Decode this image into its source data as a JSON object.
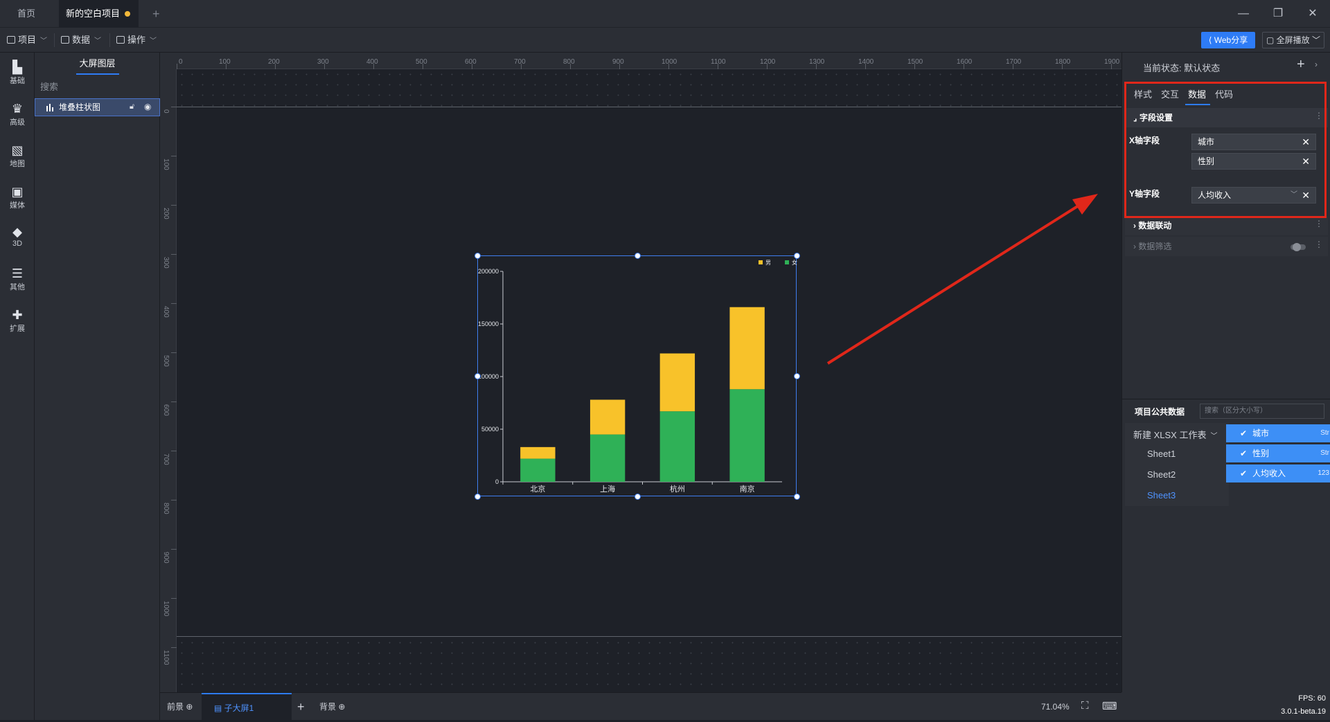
{
  "window": {
    "tabs": [
      "首页",
      "新的空白项目"
    ],
    "add_tab": "+",
    "controls": {
      "minimize": "—",
      "restore": "❐",
      "close": "✕"
    }
  },
  "menubar": {
    "items": [
      "项目",
      "数据",
      "操作"
    ],
    "web_share": "Web分享",
    "fullscreen": "全屏播放"
  },
  "iconbar": {
    "items": [
      {
        "label": "基础",
        "icon": "bar-chart-icon"
      },
      {
        "label": "高级",
        "icon": "crown-icon"
      },
      {
        "label": "地图",
        "icon": "map-icon"
      },
      {
        "label": "媒体",
        "icon": "media-icon"
      },
      {
        "label": "3D",
        "icon": "cube-icon"
      },
      {
        "label": "其他",
        "icon": "list-icon"
      },
      {
        "label": "扩展",
        "icon": "puzzle-icon"
      }
    ]
  },
  "layers": {
    "title": "大屏图层",
    "search_placeholder": "搜索",
    "items": [
      {
        "label": "堆叠柱状图"
      }
    ]
  },
  "ruler": {
    "top": [
      "0",
      "100",
      "200",
      "300",
      "400",
      "500",
      "600",
      "700",
      "800",
      "900",
      "1000",
      "1100",
      "1200",
      "1300",
      "1400",
      "1500",
      "1600",
      "1700",
      "1800",
      "1900"
    ],
    "left": [
      "0",
      "100",
      "200",
      "300",
      "400",
      "500",
      "600",
      "700",
      "800",
      "900",
      "1000",
      "1100"
    ]
  },
  "chart_data": {
    "type": "bar",
    "stacked": true,
    "categories": [
      "北京",
      "上海",
      "杭州",
      "南京"
    ],
    "series": [
      {
        "name": "女",
        "color": "#2fb157",
        "values": [
          22000,
          45000,
          67000,
          88000
        ]
      },
      {
        "name": "男",
        "color": "#f8c22a",
        "values": [
          11000,
          33000,
          55000,
          78000
        ]
      }
    ],
    "ylim": [
      0,
      200000
    ],
    "yticks": [
      "0",
      "50000",
      "100000",
      "150000",
      "200000"
    ],
    "legend": "top-right",
    "grid": false
  },
  "bottombar": {
    "front": "前景",
    "sub_screen": "子大屏1",
    "add": "+",
    "background": "背景",
    "zoom": "71.04%"
  },
  "status": {
    "fps": "FPS: 60",
    "version": "3.0.1-beta.19"
  },
  "rightpanel": {
    "state_label": "当前状态:  默认状态",
    "tabs": [
      "样式",
      "交互",
      "数据",
      "代码"
    ],
    "active_tab": "数据",
    "field_section": "字段设置",
    "x_label": "X轴字段",
    "x_fields": [
      "城市",
      "性别"
    ],
    "y_label": "Y轴字段",
    "y_field": "人均收入",
    "link_section": "数据联动",
    "filter_section": "数据筛选"
  },
  "public_data": {
    "title": "项目公共数据",
    "search_placeholder": "搜索（区分大小写）",
    "workbook": "新建 XLSX 工作表",
    "sheets": [
      "Sheet1",
      "Sheet2",
      "Sheet3"
    ],
    "active_sheet": "Sheet3",
    "columns": [
      {
        "name": "城市",
        "type": "Str"
      },
      {
        "name": "性别",
        "type": "Str"
      },
      {
        "name": "人均收入",
        "type": "123"
      }
    ]
  },
  "colors": {
    "accent": "#2e7cf6",
    "highlight": "#e0271a",
    "bg": "#1e2128",
    "panel": "#2b2e35"
  }
}
